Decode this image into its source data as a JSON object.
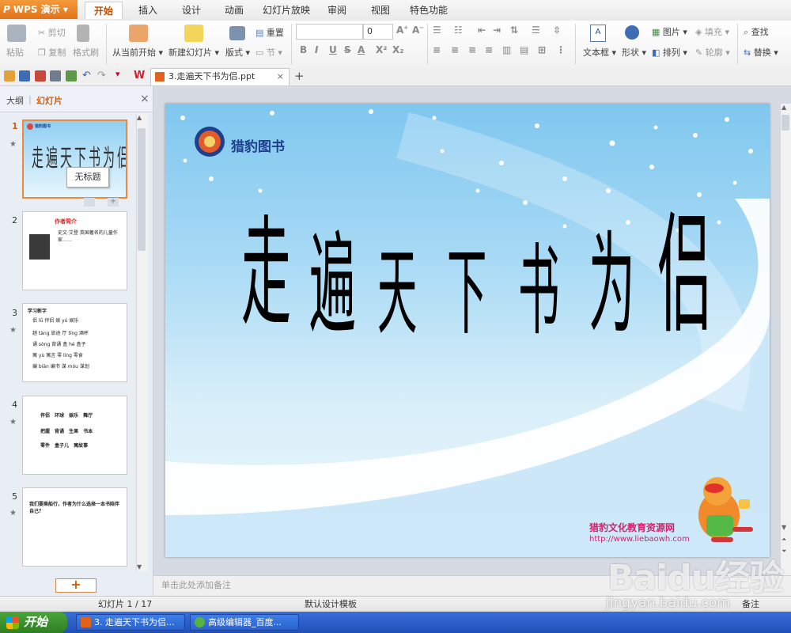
{
  "app": {
    "name": "WPS 演示",
    "logo_letter": "P",
    "accent": "#e47a20"
  },
  "tabs": [
    {
      "label": "开始",
      "active": true
    },
    {
      "label": "插入"
    },
    {
      "label": "设计"
    },
    {
      "label": "动画"
    },
    {
      "label": "幻灯片放映"
    },
    {
      "label": "审阅"
    },
    {
      "label": "视图"
    },
    {
      "label": "特色功能"
    }
  ],
  "ribbon": {
    "paste": "粘贴",
    "cut": "剪切",
    "copy": "复制",
    "format_painter": "格式刷",
    "from_current": "从当前开始",
    "new_slide": "新建幻灯片",
    "layout": "版式",
    "reset": "重置",
    "section": "节",
    "font_size": "0",
    "bold": "B",
    "italic": "I",
    "underline": "U",
    "strike": "S",
    "font_color": "A",
    "superscript": "X²",
    "subscript": "X₂",
    "textbox": "文本框",
    "shape": "形状",
    "picture": "图片",
    "fill": "填充",
    "arrange": "排列",
    "outline": "轮廓",
    "find": "查找",
    "replace": "替换"
  },
  "document": {
    "tab_title": "3.走遍天下书为侣.ppt",
    "close": "×",
    "add": "+"
  },
  "panel": {
    "tab_outline": "大纲",
    "tab_slides": "幻灯片",
    "close": "×",
    "tooltip": "无标题",
    "thumbnails": [
      {
        "num": "1",
        "title": "走遍天下书为侣"
      },
      {
        "num": "2",
        "title": "作者简介",
        "body": "史文·艾登 英国著名的儿童作家……"
      },
      {
        "num": "3",
        "title": "学习新字",
        "rows": [
          [
            "侣 lǚ",
            "伴侣",
            "娱 yú",
            "娱乐"
          ],
          [
            "趟 tàng",
            "旅途",
            "厅 tīng",
            "酒杯"
          ],
          [
            "诵 sòng",
            "背诵",
            "盒 hé",
            "盒子"
          ],
          [
            "寓 yù",
            "寓言",
            "零 líng",
            "零食"
          ],
          [
            "编 biān",
            "编书",
            "谋 móu",
            "谋划"
          ]
        ]
      },
      {
        "num": "4",
        "rows": [
          [
            "伴侣",
            "环球",
            "娱乐",
            "舞厅"
          ],
          [
            "把握",
            "背诵",
            "生果",
            "书本"
          ],
          [
            "零件",
            "盒子儿",
            "寓故事"
          ]
        ]
      },
      {
        "num": "5",
        "body": "我们要乘船行，作者为什么选择一本书陪伴自己？"
      }
    ],
    "add_slide": "+"
  },
  "slide": {
    "title_chars": [
      "走",
      "遍",
      "天",
      "下",
      "书",
      "为",
      "侣"
    ],
    "logo_text": "猎豹图书",
    "site_name": "猎豹文化教育资源网",
    "site_url": "http://www.liebaowh.com"
  },
  "notes_placeholder": "单击此处添加备注",
  "status": {
    "slide_info": "幻灯片 1 / 17",
    "template": "默认设计模板",
    "notes": "备注"
  },
  "taskbar": {
    "start": "开始",
    "items": [
      {
        "label": "3. 走遍天下书为侣...",
        "color": "#e0621d"
      },
      {
        "label": "高级编辑器_百度...",
        "color": "#55b33f"
      }
    ]
  },
  "watermark": {
    "brand": "Baidu经验",
    "url": "jingyan.baidu.com"
  }
}
